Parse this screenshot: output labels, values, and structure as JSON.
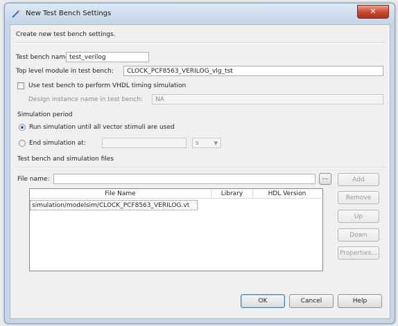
{
  "window": {
    "title": "New Test Bench Settings",
    "close_glyph": "✕"
  },
  "header_text": "Create new test bench settings.",
  "fields": {
    "test_bench_name_label": "Test bench name:",
    "test_bench_name_value": "test_verilog",
    "top_level_module_label": "Top level module in test bench:",
    "top_level_module_value": "CLOCK_PCF8563_VERILOG_vlg_tst",
    "vhdl_timing_checkbox_label": "Use test bench to perform VHDL timing simulation",
    "design_instance_label": "Design instance name in test bench:",
    "design_instance_value": "NA"
  },
  "simulation_period": {
    "group_label": "Simulation period",
    "run_until_label": "Run simulation until all vector stimuli are used",
    "end_at_label": "End simulation at:",
    "end_at_value": "",
    "unit_value": "s"
  },
  "files": {
    "group_label": "Test bench and simulation files",
    "file_name_label": "File name:",
    "file_name_value": "",
    "browse_label": "...",
    "columns": [
      "File Name",
      "Library",
      "HDL Version"
    ],
    "rows": [
      {
        "file_name": "simulation/modelsim/CLOCK_PCF8563_VERILOG.vt",
        "library": "",
        "hdl_version": ""
      }
    ],
    "buttons": {
      "add": "Add",
      "remove": "Remove",
      "up": "Up",
      "down": "Down",
      "properties": "Properties..."
    }
  },
  "footer": {
    "ok": "OK",
    "cancel": "Cancel",
    "help": "Help"
  },
  "state": {
    "vhdl_timing_checked": false,
    "run_until_selected": true,
    "end_at_selected": false
  }
}
